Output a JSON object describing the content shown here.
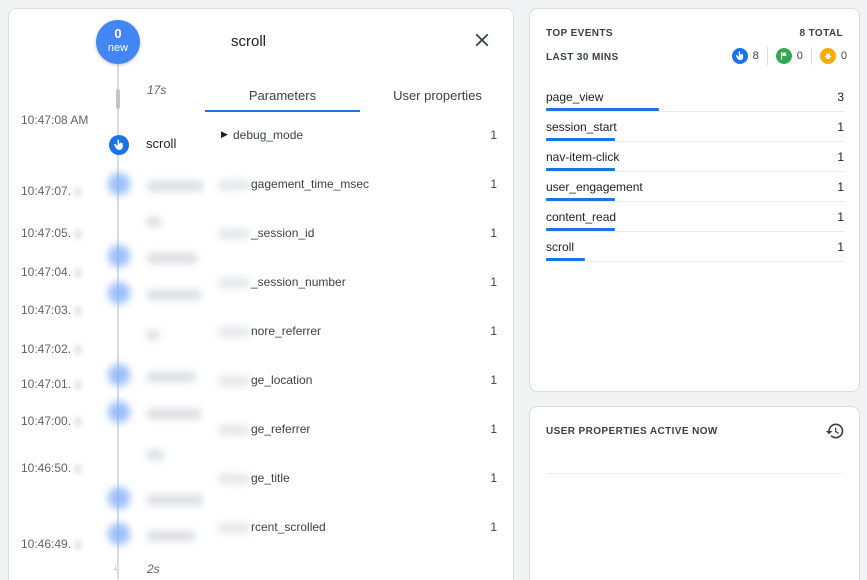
{
  "timeline": {
    "new_count": "0",
    "new_label": "new",
    "top_duration": "17s",
    "bottom_duration": "2s",
    "timestamps": [
      "10:47:08 AM",
      "10:47:07.",
      "10:47:05.",
      "10:47:04.",
      "10:47:03.",
      "10:47:02.",
      "10:47:01.",
      "10:47:00.",
      "10:46:50.",
      "10:46:49."
    ],
    "active_event": "scroll"
  },
  "params_panel": {
    "title": "scroll",
    "tabs": [
      "Parameters",
      "User properties"
    ],
    "rows": [
      {
        "name": "debug_mode",
        "value": "1"
      },
      {
        "name": "gagement_time_msec",
        "value": "1"
      },
      {
        "name": "_session_id",
        "value": "1"
      },
      {
        "name": "_session_number",
        "value": "1"
      },
      {
        "name": "nore_referrer",
        "value": "1"
      },
      {
        "name": "ge_location",
        "value": "1"
      },
      {
        "name": "ge_referrer",
        "value": "1"
      },
      {
        "name": "ge_title",
        "value": "1"
      },
      {
        "name": "rcent_scrolled",
        "value": "1"
      }
    ]
  },
  "top_events": {
    "title": "TOP EVENTS",
    "total": "8 TOTAL",
    "subtitle": "LAST 30 MINS",
    "counts": {
      "events": "8",
      "conversions": "0",
      "errors": "0"
    },
    "colors": {
      "events": "#1a73e8",
      "conversions": "#34a853",
      "errors": "#f9ab00"
    },
    "rows": [
      {
        "name": "page_view",
        "count": "3",
        "fill": 0.38
      },
      {
        "name": "session_start",
        "count": "1",
        "fill": 0.23
      },
      {
        "name": "nav-item-click",
        "count": "1",
        "fill": 0.23
      },
      {
        "name": "user_engagement",
        "count": "1",
        "fill": 0.23
      },
      {
        "name": "content_read",
        "count": "1",
        "fill": 0.23
      },
      {
        "name": "scroll",
        "count": "1",
        "fill": 0.13
      }
    ]
  },
  "user_properties": {
    "title": "USER PROPERTIES ACTIVE NOW"
  }
}
